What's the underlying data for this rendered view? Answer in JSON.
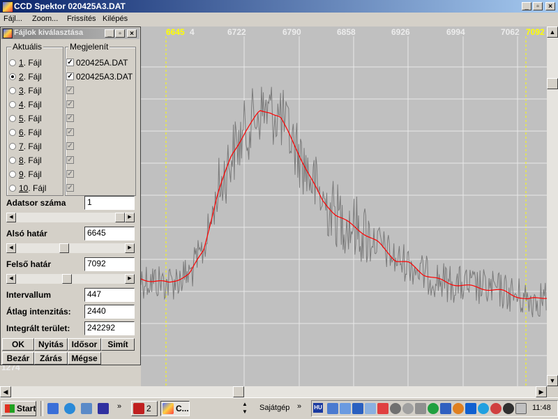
{
  "window": {
    "title": "CCD Spektor 020425A3.DAT"
  },
  "menu": [
    "Fájl...",
    "Zoom...",
    "Frissítés",
    "Kilépés"
  ],
  "plot": {
    "x_ticks": [
      "6722",
      "6790",
      "6858",
      "6926",
      "6994",
      "7062"
    ],
    "left_marker": "6645",
    "left_marker_suffix": "4",
    "right_marker": "7092",
    "y_label": "1274"
  },
  "dialog": {
    "title": "Fájlok kiválasztása",
    "aktualis_label": "Aktuális",
    "megjelenit_label": "Megjelenít",
    "files": [
      {
        "num": "1",
        "label": ". Fájl"
      },
      {
        "num": "2",
        "label": ". Fájl"
      },
      {
        "num": "3",
        "label": ". Fájl"
      },
      {
        "num": "4",
        "label": ". Fájl"
      },
      {
        "num": "5",
        "label": ". Fájl"
      },
      {
        "num": "6",
        "label": ". Fájl"
      },
      {
        "num": "7",
        "label": ". Fájl"
      },
      {
        "num": "8",
        "label": ". Fájl"
      },
      {
        "num": "9",
        "label": ". Fájl"
      },
      {
        "num": "10",
        "label": ". Fájl"
      }
    ],
    "selected_file_index": 1,
    "display_files": [
      "020425A.DAT",
      "020425A3.DAT"
    ],
    "adatsor_label": "Adatsor száma",
    "adatsor_value": "1",
    "also_label": "Alsó határ",
    "also_value": "6645",
    "felso_label": "Felső határ",
    "felso_value": "7092",
    "intervallum_label": "Intervallum",
    "intervallum_value": "447",
    "atlag_label": "Átlag intenzitás:",
    "atlag_value": "2440",
    "integralt_label": "Integrált terület:",
    "integralt_value": "242292",
    "buttons": {
      "ok": "OK",
      "nyitas": "Nyitás",
      "idosor": "Idősor",
      "simit": "Simít",
      "bezar": "Bezár",
      "zaras": "Zárás",
      "megse": "Mégse"
    }
  },
  "taskbar": {
    "start": "Start",
    "group_count": "2",
    "task_label": "C...",
    "sajatgep": "Sajátgép",
    "lang": "HU",
    "clock": "11:48"
  },
  "colors": {
    "smooth_line": "#ff0000",
    "raw_line": "#808080",
    "marker": "#ffff00",
    "plot_bg": "#c0c0c0"
  }
}
